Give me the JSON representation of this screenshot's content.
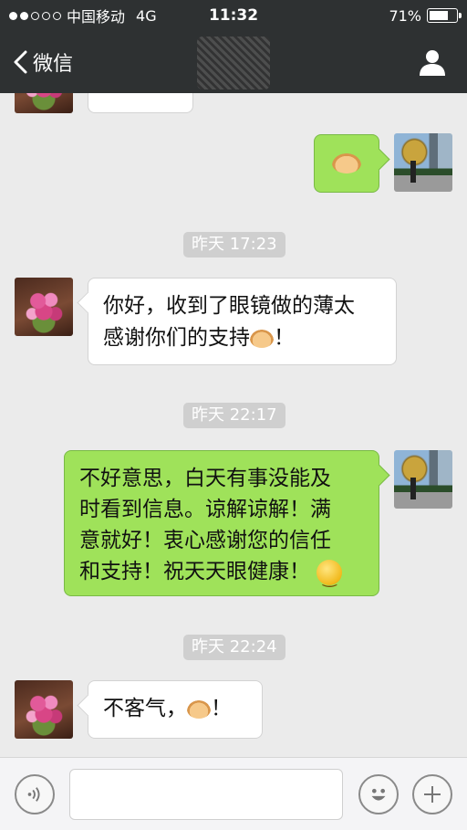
{
  "status_bar": {
    "signal_dots": [
      true,
      true,
      false,
      false,
      false
    ],
    "carrier": "中国移动",
    "network": "4G",
    "time": "11:32",
    "battery_percent": "71%",
    "battery_level": 0.71
  },
  "nav": {
    "back_label": "微信",
    "back_icon": "chevron-left-icon",
    "profile_icon": "person-icon"
  },
  "chat": {
    "partial_top_text": "",
    "messages": [
      {
        "type": "sent",
        "content": "handshake-emoji"
      },
      {
        "type": "timestamp",
        "text": "昨天 17:23"
      },
      {
        "type": "received",
        "line1": "你好，收到了眼镜做的薄太",
        "line2_text": "感谢你们的支持",
        "line2_suffix": "！"
      },
      {
        "type": "timestamp",
        "text": "昨天 22:17"
      },
      {
        "type": "sent",
        "lines": [
          "不好意思，白天有事没能及",
          "时看到信息。谅解谅解！满",
          "意就好！衷心感谢您的信任",
          "和支持！祝天天眼健康！"
        ]
      },
      {
        "type": "timestamp",
        "text": "昨天 22:24"
      },
      {
        "type": "received",
        "text": "不客气，",
        "suffix": "！"
      }
    ]
  },
  "input_bar": {
    "voice_icon": "voice-icon",
    "emoji_icon": "smiley-icon",
    "plus_icon": "plus-icon",
    "placeholder": ""
  },
  "colors": {
    "bar_bg": "#2e3132",
    "chat_bg": "#ebebeb",
    "sent_bubble": "#9fe25a",
    "received_bubble": "#ffffff",
    "timestamp_bg": "#cfcfcf"
  }
}
